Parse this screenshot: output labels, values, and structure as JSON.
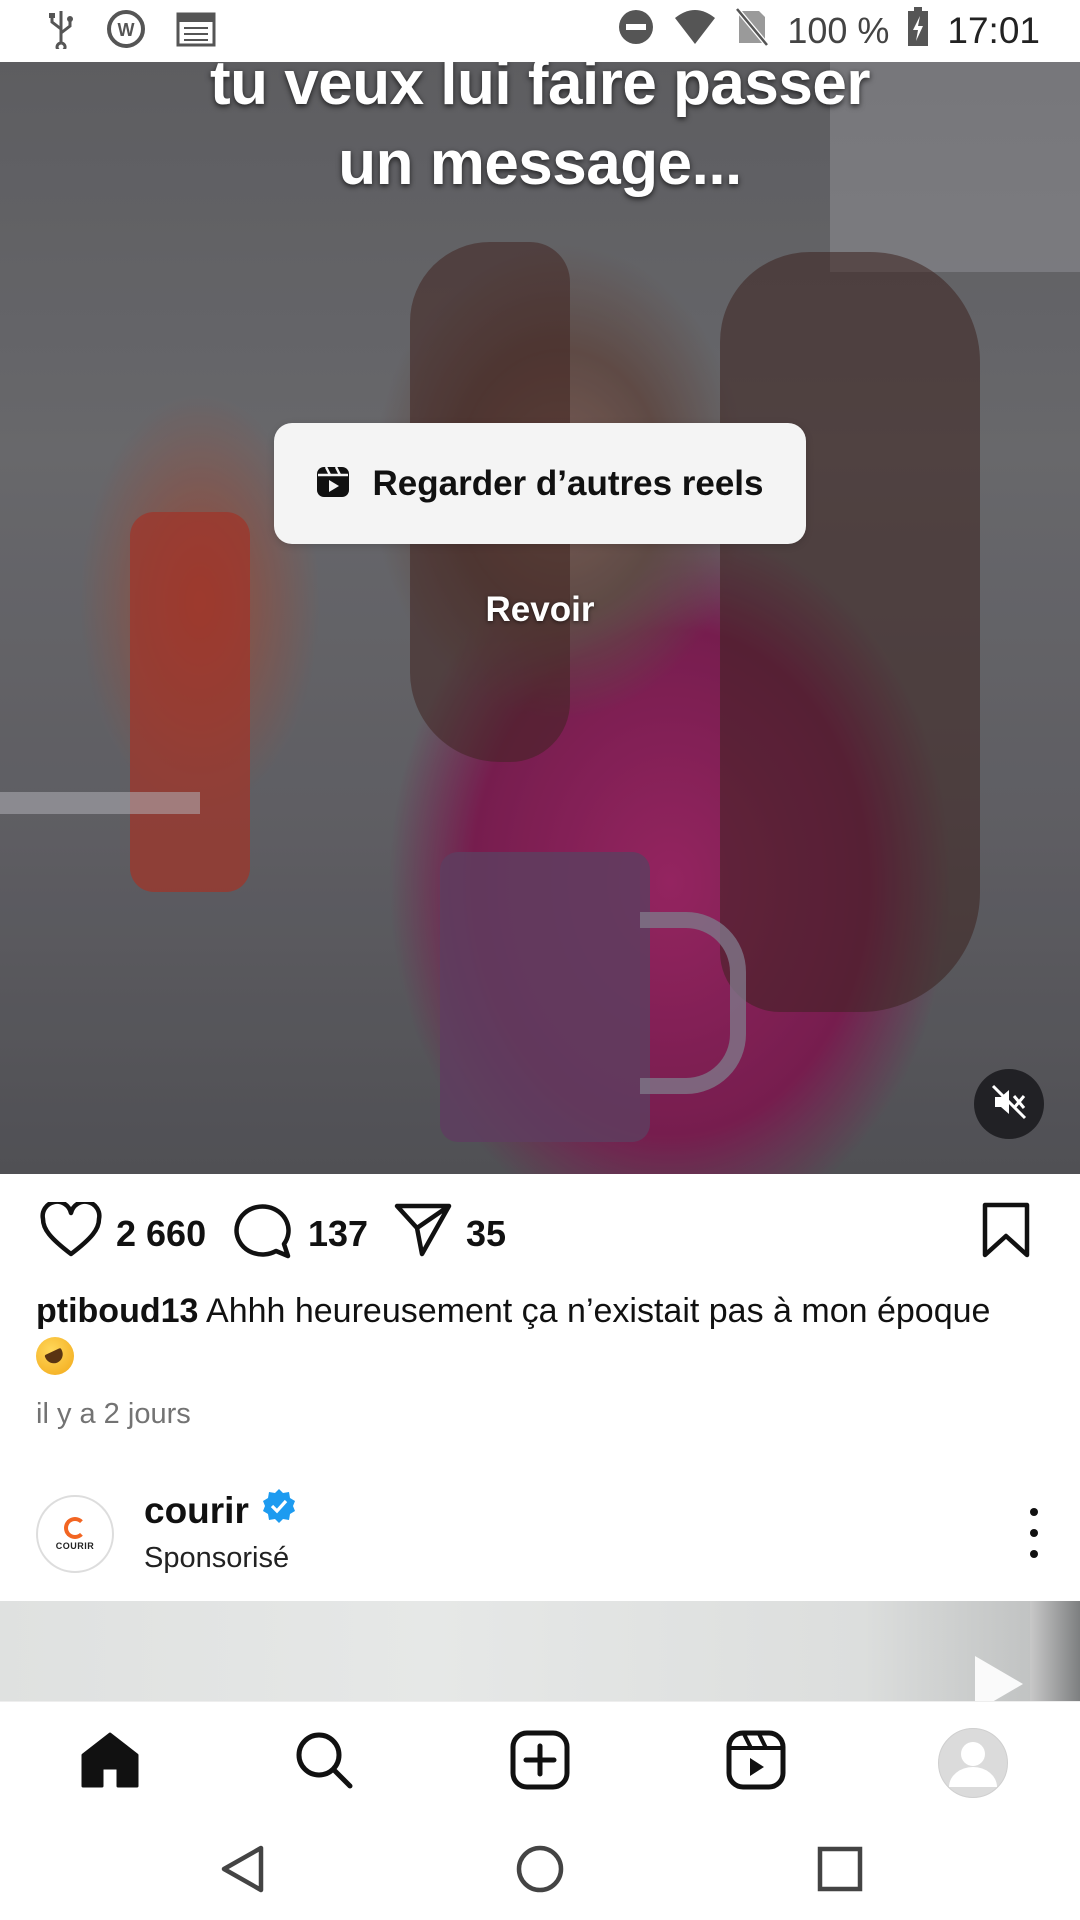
{
  "status_bar": {
    "battery": "100 %",
    "time": "17:01",
    "icons": [
      "usb-icon",
      "vpn-icon",
      "calendar-icon",
      "dnd-icon",
      "wifi-icon",
      "no-sim-icon",
      "battery-icon"
    ]
  },
  "video": {
    "overlay_line1": "tu veux lui faire passer",
    "overlay_line2": "un message...",
    "more_reels_label": "Regarder d’autres reels",
    "replay_label": "Revoir"
  },
  "actions": {
    "likes": "2 660",
    "comments": "137",
    "shares": "35"
  },
  "caption": {
    "username": "ptiboud13",
    "text": "Ahhh heureusement ça n’existait pas à mon époque",
    "time_ago": "il y a 2 jours"
  },
  "sponsored_post": {
    "account": "courir",
    "avatar_text": "COURIR",
    "subtitle": "Sponsorisé"
  },
  "bottom_nav": [
    "home",
    "search",
    "create",
    "reels",
    "profile"
  ],
  "colors": {
    "verified": "#1d9bf0",
    "courir_orange": "#f26522",
    "reels_button_bg": "#f4f4f4"
  }
}
